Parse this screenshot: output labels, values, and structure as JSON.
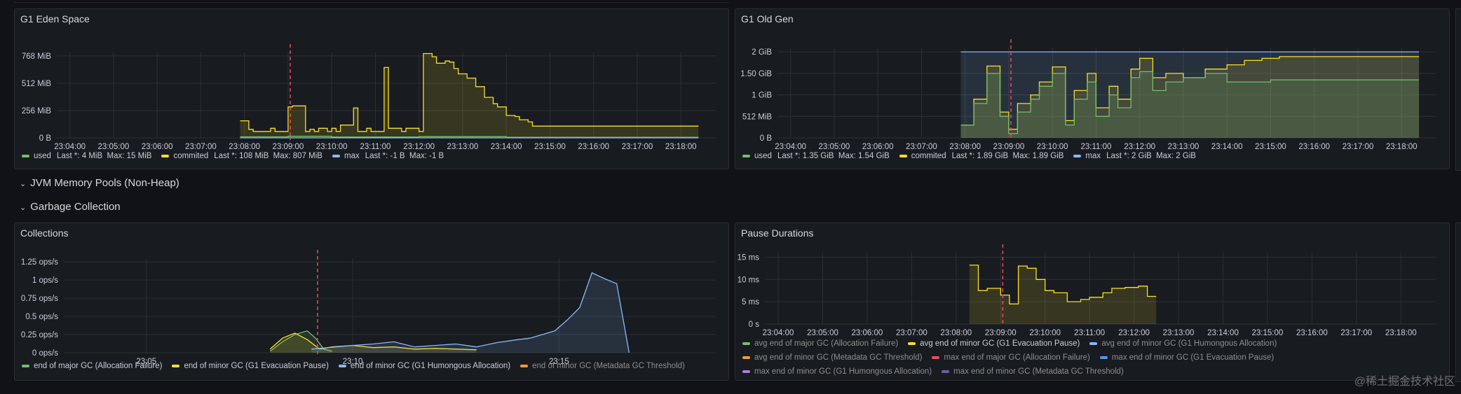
{
  "panels": {
    "eden": {
      "title": "G1 Eden Space",
      "y_labels": [
        "768 MiB",
        "512 MiB",
        "256 MiB",
        "0 B"
      ],
      "x_labels": [
        "23:04:00",
        "23:05:00",
        "23:06:00",
        "23:07:00",
        "23:08:00",
        "23:09:00",
        "23:10:00",
        "23:11:00",
        "23:12:00",
        "23:13:00",
        "23:14:00",
        "23:15:00",
        "23:16:00",
        "23:17:00",
        "23:18:00"
      ],
      "legend": [
        {
          "name": "used",
          "color": "#73bf69",
          "stats": "Last *: 4 MiB  Max: 15 MiB"
        },
        {
          "name": "commited",
          "color": "#fade2a",
          "stats": "Last *: 108 MiB  Max: 807 MiB"
        },
        {
          "name": "max",
          "color": "#8ab8ff",
          "stats": "Last *: -1 B  Max: -1 B"
        }
      ]
    },
    "oldgen": {
      "title": "G1 Old Gen",
      "y_labels": [
        "2 GiB",
        "1.50 GiB",
        "1 GiB",
        "512 MiB",
        "0 B"
      ],
      "x_labels": [
        "23:04:00",
        "23:05:00",
        "23:06:00",
        "23:07:00",
        "23:08:00",
        "23:09:00",
        "23:10:00",
        "23:11:00",
        "23:12:00",
        "23:13:00",
        "23:14:00",
        "23:15:00",
        "23:16:00",
        "23:17:00",
        "23:18:00"
      ],
      "legend": [
        {
          "name": "used",
          "color": "#73bf69",
          "stats": "Last *: 1.35 GiB  Max: 1.54 GiB"
        },
        {
          "name": "commited",
          "color": "#fade2a",
          "stats": "Last *: 1.89 GiB  Max: 1.89 GiB"
        },
        {
          "name": "max",
          "color": "#8ab8ff",
          "stats": "Last *: 2 GiB  Max: 2 GiB"
        }
      ]
    },
    "collections": {
      "title": "Collections",
      "y_labels": [
        "1.25 ops/s",
        "1 ops/s",
        "0.75 ops/s",
        "0.5 ops/s",
        "0.25 ops/s",
        "0 ops/s"
      ],
      "x_labels": [
        "23:05",
        "23:10",
        "23:15"
      ],
      "legend": [
        {
          "name": "end of major GC (Allocation Failure)",
          "color": "#73bf69"
        },
        {
          "name": "end of minor GC (G1 Evacuation Pause)",
          "color": "#fade2a"
        },
        {
          "name": "end of minor GC (G1 Humongous Allocation)",
          "color": "#8ab8ff"
        },
        {
          "name": "end of minor GC (Metadata GC Threshold)",
          "color": "#ff9830",
          "muted": true
        }
      ]
    },
    "pauses": {
      "title": "Pause Durations",
      "y_labels": [
        "15 ms",
        "10 ms",
        "5 ms",
        "0 s"
      ],
      "x_labels": [
        "23:04:00",
        "23:05:00",
        "23:06:00",
        "23:07:00",
        "23:08:00",
        "23:09:00",
        "23:10:00",
        "23:11:00",
        "23:12:00",
        "23:13:00",
        "23:14:00",
        "23:15:00",
        "23:16:00",
        "23:17:00",
        "23:18:00"
      ],
      "legend_rows": [
        [
          {
            "name": "avg end of major GC (Allocation Failure)",
            "color": "#73bf69",
            "muted": true
          },
          {
            "name": "avg end of minor GC (G1 Evacuation Pause)",
            "color": "#fade2a"
          },
          {
            "name": "avg end of minor GC (G1 Humongous Allocation)",
            "color": "#8ab8ff",
            "muted": true
          }
        ],
        [
          {
            "name": "avg end of minor GC (Metadata GC Threshold)",
            "color": "#ff9830",
            "muted": true
          },
          {
            "name": "max end of major GC (Allocation Failure)",
            "color": "#f2495c",
            "muted": true
          },
          {
            "name": "max end of minor GC (G1 Evacuation Pause)",
            "color": "#5794f2",
            "muted": true
          }
        ],
        [
          {
            "name": "max end of minor GC (G1 Humongous Allocation)",
            "color": "#b877d9",
            "muted": true
          },
          {
            "name": "max end of minor GC (Metadata GC Threshold)",
            "color": "#705da0",
            "muted": true
          }
        ]
      ]
    }
  },
  "rows": {
    "nonheap": "JVM Memory Pools (Non-Heap)",
    "gc": "Garbage Collection"
  },
  "watermark": "@稀土掘金技术社区",
  "colors": {
    "accent_green": "#73bf69",
    "accent_yellow": "#fade2a",
    "accent_blue": "#8ab8ff",
    "annotation": "#f2495c"
  },
  "chart_data": [
    {
      "type": "line",
      "title": "G1 Eden Space",
      "ylim": [
        0,
        900
      ],
      "yunit": "MiB",
      "series": [
        {
          "name": "commited",
          "x": [
            7.9,
            8.1,
            8.2,
            8.6,
            8.7,
            9.0,
            9.1,
            9.4,
            9.5,
            9.6,
            9.7,
            9.9,
            10.0,
            10.1,
            10.2,
            10.5,
            10.6,
            10.8,
            10.9,
            11.2,
            11.3,
            11.6,
            11.7,
            12.0,
            12.1,
            12.3,
            12.4,
            12.6,
            12.7,
            12.8,
            12.9,
            13.1,
            13.3,
            13.5,
            13.7,
            13.8,
            14.0,
            14.2,
            14.3,
            14.5,
            14.6,
            18.4
          ],
          "values": [
            160,
            80,
            60,
            90,
            60,
            290,
            300,
            60,
            80,
            60,
            90,
            60,
            90,
            60,
            120,
            280,
            60,
            90,
            60,
            660,
            90,
            60,
            90,
            60,
            790,
            760,
            700,
            720,
            710,
            650,
            600,
            560,
            480,
            380,
            320,
            290,
            210,
            200,
            170,
            150,
            110,
            108
          ]
        },
        {
          "name": "used",
          "x": [
            7.9,
            9.0,
            10.0,
            12.0,
            14.0,
            18.4
          ],
          "values": [
            10,
            15,
            8,
            12,
            6,
            4
          ]
        },
        {
          "name": "max",
          "x": [
            7.9,
            18.4
          ],
          "values": [
            -1,
            -1
          ]
        }
      ]
    },
    {
      "type": "line",
      "title": "G1 Old Gen",
      "ylim": [
        0,
        2.2
      ],
      "yunit": "GiB",
      "series": [
        {
          "name": "max",
          "x": [
            7.9,
            18.4
          ],
          "values": [
            2,
            2
          ]
        },
        {
          "name": "commited",
          "x": [
            7.9,
            8.2,
            8.5,
            8.8,
            9.0,
            9.2,
            9.5,
            9.7,
            10.0,
            10.3,
            10.5,
            10.8,
            11.0,
            11.3,
            11.5,
            11.8,
            12.0,
            12.3,
            12.6,
            13.0,
            13.5,
            14.0,
            14.4,
            14.8,
            15.2,
            18.4
          ],
          "values": [
            0.3,
            0.9,
            1.67,
            0.6,
            0.2,
            0.8,
            1.0,
            1.3,
            1.65,
            0.4,
            1.1,
            1.5,
            0.7,
            1.2,
            0.9,
            1.6,
            1.85,
            1.4,
            1.5,
            1.4,
            1.6,
            1.7,
            1.8,
            1.85,
            1.89,
            1.89
          ]
        },
        {
          "name": "used",
          "x": [
            7.9,
            8.2,
            8.5,
            8.8,
            9.0,
            9.2,
            9.5,
            9.7,
            10.0,
            10.3,
            10.5,
            10.8,
            11.0,
            11.3,
            11.5,
            11.8,
            12.0,
            12.3,
            12.6,
            13.0,
            13.5,
            14.0,
            14.5,
            15.0,
            18.4
          ],
          "values": [
            0.3,
            0.8,
            1.5,
            0.5,
            0.1,
            0.6,
            0.9,
            1.2,
            1.5,
            0.3,
            0.9,
            1.3,
            0.5,
            1.0,
            0.7,
            1.4,
            1.54,
            1.1,
            1.3,
            1.4,
            1.5,
            1.3,
            1.3,
            1.35,
            1.35
          ]
        }
      ]
    },
    {
      "type": "area",
      "title": "Collections",
      "ylim": [
        0,
        1.3
      ],
      "yunit": "ops/s",
      "series": [
        {
          "name": "end of major GC (Allocation Failure)",
          "x": [
            8.0,
            8.3,
            8.6,
            8.9,
            9.1,
            9.3,
            9.5
          ],
          "values": [
            0.02,
            0.15,
            0.25,
            0.3,
            0.2,
            0.05,
            0.02
          ]
        },
        {
          "name": "end of minor GC (G1 Evacuation Pause)",
          "x": [
            8.0,
            8.3,
            8.6,
            8.9,
            9.2,
            9.5,
            10.0,
            10.5,
            11.0,
            11.5,
            12.0,
            12.5,
            13.0
          ],
          "values": [
            0.05,
            0.2,
            0.27,
            0.18,
            0.05,
            0.08,
            0.1,
            0.07,
            0.08,
            0.05,
            0.06,
            0.05,
            0.04
          ]
        },
        {
          "name": "end of minor GC (G1 Humongous Allocation)",
          "x": [
            9.0,
            10.0,
            10.5,
            11.0,
            11.5,
            12.0,
            12.5,
            13.0,
            13.5,
            14.0,
            14.3,
            14.6,
            14.9,
            15.2,
            15.5,
            15.8,
            16.1,
            16.4,
            16.7
          ],
          "values": [
            0.05,
            0.1,
            0.12,
            0.15,
            0.08,
            0.1,
            0.12,
            0.08,
            0.14,
            0.18,
            0.2,
            0.25,
            0.3,
            0.45,
            0.62,
            1.1,
            1.02,
            0.95,
            0.0
          ]
        },
        {
          "name": "end of minor GC (Metadata GC Threshold)",
          "x": [],
          "values": []
        }
      ]
    },
    {
      "type": "line",
      "title": "Pause Durations",
      "ylim": [
        0,
        16
      ],
      "yunit": "ms",
      "series": [
        {
          "name": "avg end of minor GC (G1 Evacuation Pause)",
          "x": [
            8.3,
            8.5,
            8.7,
            9.0,
            9.2,
            9.4,
            9.6,
            9.8,
            10.0,
            10.2,
            10.5,
            10.8,
            11.0,
            11.3,
            11.5,
            11.8,
            12.1,
            12.3,
            12.5
          ],
          "values": [
            13.2,
            7.5,
            8.0,
            6.5,
            4.5,
            13.0,
            12.5,
            10.0,
            7.5,
            7.0,
            5.0,
            5.5,
            6.0,
            7.0,
            8.0,
            8.2,
            8.5,
            6.2,
            6.2
          ]
        }
      ]
    }
  ]
}
